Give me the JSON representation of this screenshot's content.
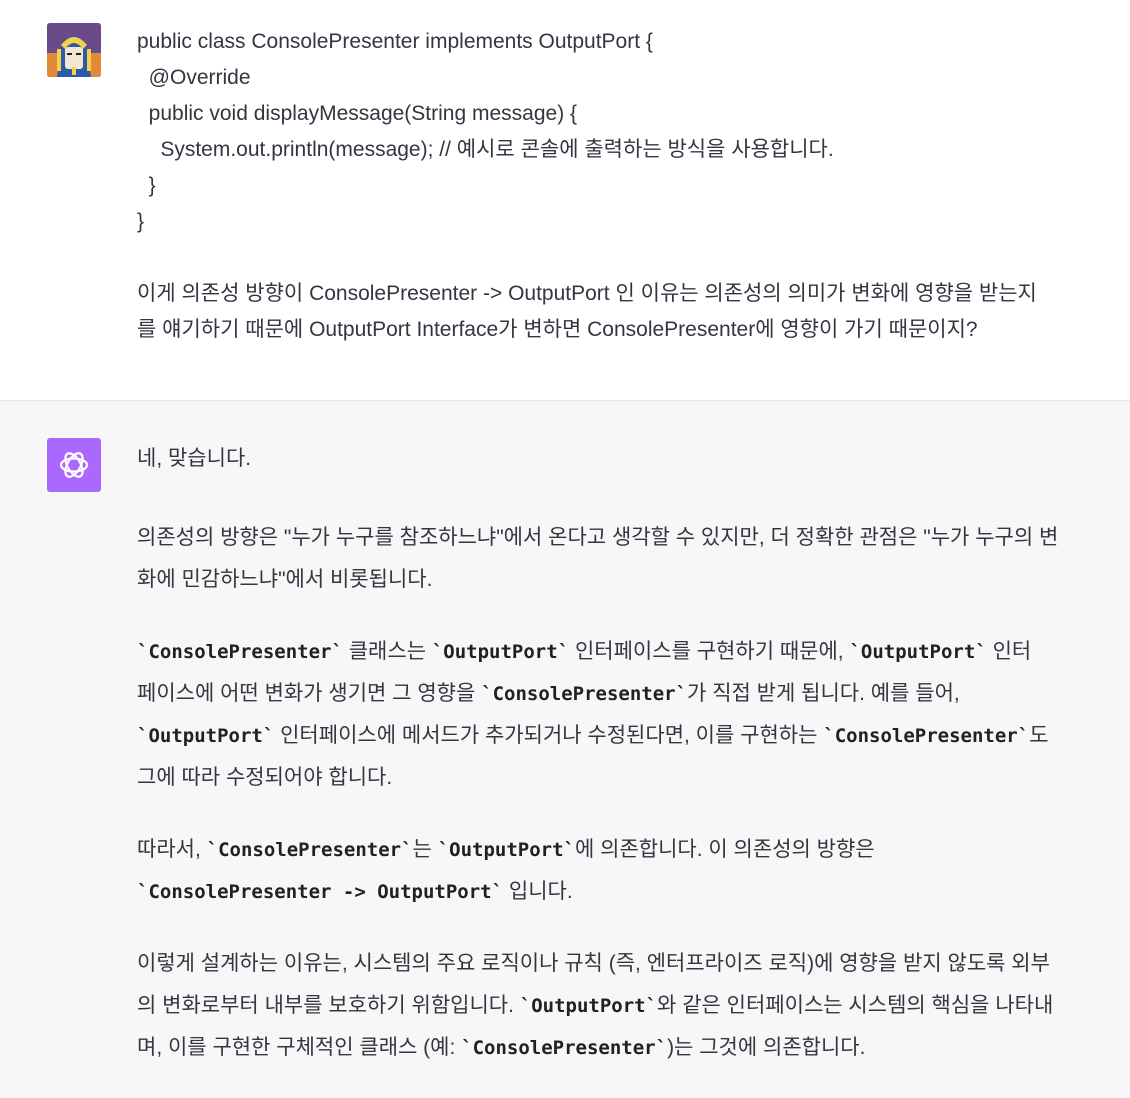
{
  "user_message": {
    "code_lines": [
      "public class ConsolePresenter implements OutputPort {",
      "  @Override",
      "  public void displayMessage(String message) {",
      "    System.out.println(message); // 예시로 콘솔에 출력하는 방식을 사용합니다.",
      "  }",
      "}"
    ],
    "question_line1": "이게 의존성 방향이 ConsolePresenter -> OutputPort 인 이유는 의존성의 의미가 변화에 영향을 받는지",
    "question_line2": "를 얘기하기 때문에 OutputPort Interface가 변하면 ConsolePresenter에 영향이 가기 때문이지?"
  },
  "assistant_message": {
    "p1": "네, 맞습니다.",
    "p2_line1": "의존성의 방향은 \"누가 누구를 참조하느냐\"에서 온다고 생각할 수 있지만, 더 정확한 관점은 \"누가 누구의 변",
    "p2_line2": "화에 민감하느냐\"에서 비롯됩니다.",
    "p3": {
      "c1": "`ConsolePresenter`",
      "t1": " 클래스는 ",
      "c2": "`OutputPort`",
      "t2": " 인터페이스를 구현하기 때문에, ",
      "c3": "`OutputPort`",
      "t3": " 인터",
      "t4": "페이스에 어떤 변화가 생기면 그 영향을 ",
      "c4": "`ConsolePresenter`",
      "t5": "가 직접 받게 됩니다. 예를 들어,",
      "c5": "`OutputPort`",
      "t6": " 인터페이스에 메서드가 추가되거나 수정된다면, 이를 구현하는 ",
      "c6": "`ConsolePresenter`",
      "t7": "도",
      "t8": "그에 따라 수정되어야 합니다."
    },
    "p4": {
      "t1": "따라서, ",
      "c1": "`ConsolePresenter`",
      "t2": "는 ",
      "c2": "`OutputPort`",
      "t3": "에 의존합니다. 이 의존성의 방향은",
      "c3": "`ConsolePresenter -> OutputPort`",
      "t4": " 입니다."
    },
    "p5": {
      "t1": "이렇게 설계하는 이유는, 시스템의 주요 로직이나 규칙 (즉, 엔터프라이즈 로직)에 영향을 받지 않도록 외부",
      "t2": "의 변화로부터 내부를 보호하기 위함입니다. ",
      "c1": "`OutputPort`",
      "t3": "와 같은 인터페이스는 시스템의 핵심을 나타내",
      "t4": "며, 이를 구현한 구체적인 클래스 (예: ",
      "c2": "`ConsolePresenter`",
      "t5": ")는 그것에 의존합니다."
    }
  }
}
